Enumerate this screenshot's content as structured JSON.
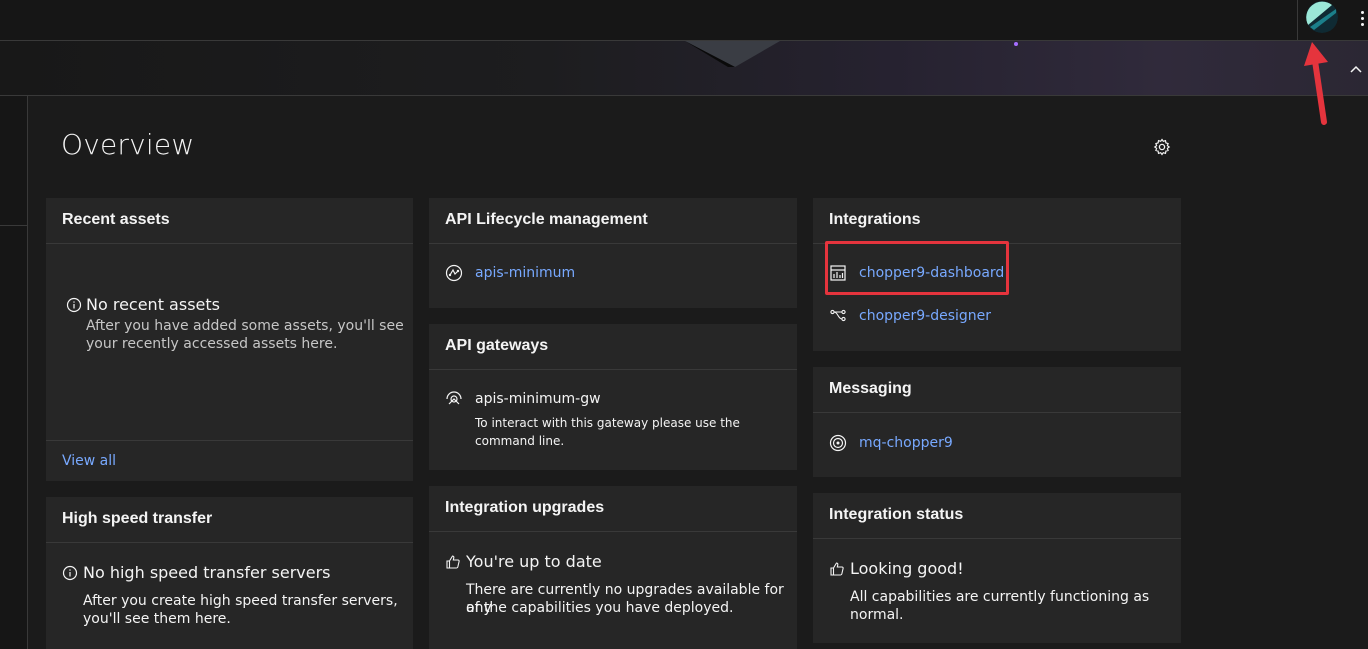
{
  "page": {
    "title": "Overview"
  },
  "colors": {
    "link": "#78a9ff",
    "tile_bg": "#262626",
    "page_bg": "#1b1b1b",
    "annotation": "#e5343d"
  },
  "header": {
    "logo_icon": "app-logo-icon",
    "menu_icon": "overflow-menu-icon"
  },
  "banner": {
    "collapse_icon": "chevron-up-icon"
  },
  "recent_assets": {
    "title": "Recent assets",
    "empty_title": "No recent assets",
    "empty_line1": "After you have added some assets, you'll see",
    "empty_line2": "your recently accessed assets here.",
    "view_all": "View all"
  },
  "high_speed_transfer": {
    "title": "High speed transfer",
    "empty_title": "No high speed transfer servers",
    "empty_line1": "After you create high speed transfer servers,",
    "empty_line2": "you'll see them here."
  },
  "api_lifecycle": {
    "title": "API Lifecycle management",
    "items": [
      {
        "label": "apis-minimum",
        "icon": "api-icon"
      }
    ]
  },
  "api_gateways": {
    "title": "API gateways",
    "items": [
      {
        "label": "apis-minimum-gw",
        "icon": "gateway-icon",
        "desc_line1": "To interact with this gateway please use the",
        "desc_line2": "command line."
      }
    ]
  },
  "integration_upgrades": {
    "title": "Integration upgrades",
    "status_title": "You're up to date",
    "line1": "There are currently no upgrades available for any",
    "line2": "of the capabilities you have deployed."
  },
  "integrations": {
    "title": "Integrations",
    "items": [
      {
        "label": "chopper9-dashboard",
        "icon": "dashboard-icon"
      },
      {
        "label": "chopper9-designer",
        "icon": "flow-icon"
      }
    ]
  },
  "messaging": {
    "title": "Messaging",
    "items": [
      {
        "label": "mq-chopper9",
        "icon": "queue-manager-icon"
      }
    ]
  },
  "integration_status": {
    "title": "Integration status",
    "status_title": "Looking good!",
    "line1": "All capabilities are currently functioning as",
    "line2": "normal."
  }
}
